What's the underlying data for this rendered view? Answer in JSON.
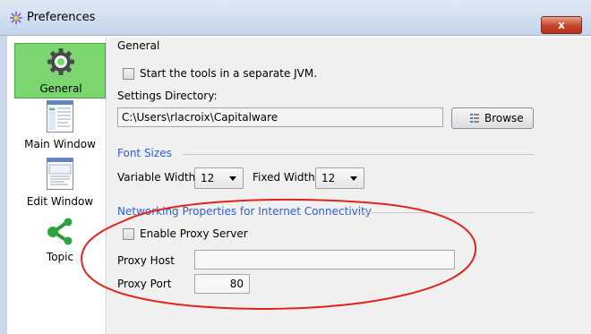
{
  "window": {
    "title": "Preferences",
    "close_label": "x"
  },
  "sidebar": {
    "items": [
      {
        "label": "General",
        "icon": "gear-icon",
        "selected": true
      },
      {
        "label": "Main Window",
        "icon": "main-window-thumbnail-icon",
        "selected": false
      },
      {
        "label": "Edit Window",
        "icon": "edit-window-thumbnail-icon",
        "selected": false
      },
      {
        "label": "Topic",
        "icon": "topic-network-icon",
        "selected": false
      }
    ]
  },
  "general": {
    "section_title": "General",
    "separate_jvm_label": "Start the tools in a separate JVM.",
    "separate_jvm_checked": false,
    "settings_dir_label": "Settings Directory:",
    "settings_dir_value": "C:\\Users\\rlacroix\\Capitalware",
    "browse_label": "Browse"
  },
  "fonts": {
    "group_label": "Font Sizes",
    "variable_width_label": "Variable Width:",
    "variable_width_value": "12",
    "fixed_width_label": "Fixed Width:",
    "fixed_width_value": "12"
  },
  "network": {
    "group_label": "Networking Properties for Internet Connectivity",
    "enable_proxy_label": "Enable Proxy Server",
    "enable_proxy_checked": false,
    "proxy_host_label": "Proxy Host",
    "proxy_host_value": "",
    "proxy_port_label": "Proxy Port",
    "proxy_port_value": "80"
  },
  "colors": {
    "selected_item": "#7cd670",
    "group_label": "#2c5fd4",
    "annotation": "#e0241b"
  }
}
